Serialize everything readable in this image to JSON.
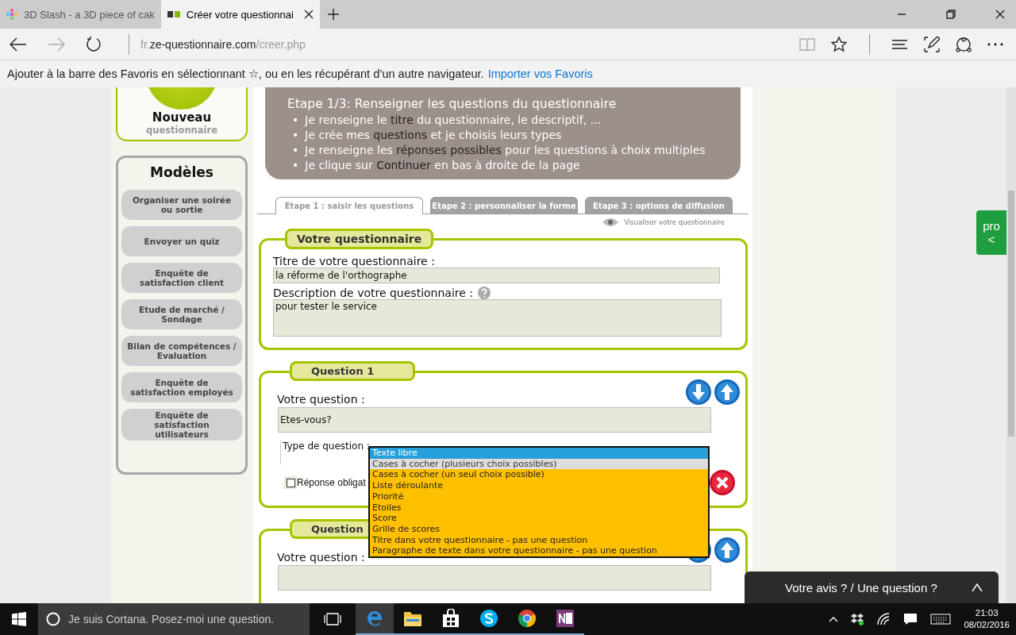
{
  "browser": {
    "tabs": [
      {
        "title": "3D Slash - a 3D piece of cak",
        "kind": "pixels",
        "selected": false
      },
      {
        "title": "Créer votre questionnai",
        "kind": "ze",
        "selected": true
      }
    ],
    "url_parts": [
      {
        "text": "fr.",
        "emphasis": false
      },
      {
        "text": "ze-questionnaire.com",
        "emphasis": true
      },
      {
        "text": "/creer.php",
        "emphasis": false
      }
    ],
    "favorites_bar": {
      "message": "Ajouter à la barre des Favoris en sélectionnant ☆, ou en les récupérant d’un autre navigateur.",
      "link": "Importer vos Favoris"
    }
  },
  "sidebar": {
    "new_button": {
      "title": "Nouveau",
      "subtitle": "questionnaire"
    },
    "templates": {
      "title": "Modèles",
      "items": [
        "Organiser une soirée ou sortie",
        "Envoyer un quiz",
        "Enquête de satisfaction client",
        "Etude de marché / Sondage",
        "Bilan de compétences / Evaluation",
        "Enquête de satisfaction employés",
        "Enquête de satisfaction utilisateurs"
      ]
    }
  },
  "header": {
    "step": "Etape 1/3: Renseigner les questions du questionnaire",
    "bullets": [
      {
        "marker": "•",
        "text": "Je renseigne le **titre** du questionnaire, le descriptif, ..."
      },
      {
        "marker": "•",
        "text": "Je crée mes **questions** et je choisis leurs types"
      },
      {
        "marker": "•",
        "text": "Je renseigne les **réponses possibles** pour les questions à choix multiples"
      },
      {
        "marker": "•",
        "text": "Je clique sur **Continuer** en bas à droite de la page"
      }
    ]
  },
  "step_tabs": [
    {
      "label": "Etape 1 : saisir les questions",
      "selected": true
    },
    {
      "label": "Etape 2 : personnaliser la forme",
      "selected": false
    },
    {
      "label": "Etape 3 : options de diffusion",
      "selected": false
    }
  ],
  "preview_link": "Visualiser votre questionnaire",
  "questionnaire": {
    "heading": "Votre questionnaire",
    "title_label": "Titre de votre questionnaire :",
    "title_value": "la réforme de l'orthographe",
    "description_label": "Description de votre questionnaire :",
    "description_value": "pour tester le service"
  },
  "questions": [
    {
      "heading": "Question 1",
      "question_label": "Votre question :",
      "question_value": "Etes-vous?",
      "type_label": "Type de question :",
      "required_label": "Réponse obligat",
      "required": false
    },
    {
      "heading": "Question",
      "question_label": "Votre question :"
    }
  ],
  "type_dropdown": {
    "options": [
      {
        "label": "Texte libre",
        "selected": true,
        "hovered": false
      },
      {
        "label": "Cases à cocher (plusieurs choix possibles)",
        "selected": false,
        "hovered": true
      },
      {
        "label": "Cases à cocher (un seul choix possible)",
        "selected": false,
        "hovered": false
      },
      {
        "label": "Liste déroulante",
        "selected": false,
        "hovered": false
      },
      {
        "label": "Priorité",
        "selected": false,
        "hovered": false
      },
      {
        "label": "Etoiles",
        "selected": false,
        "hovered": false
      },
      {
        "label": "Score",
        "selected": false,
        "hovered": false
      },
      {
        "label": "Grille de scores",
        "selected": false,
        "hovered": false
      },
      {
        "label": "Titre dans votre questionnaire - pas une question",
        "selected": false,
        "hovered": false
      },
      {
        "label": "Paragraphe de texte dans votre questionnaire - pas une question",
        "selected": false,
        "hovered": false
      }
    ]
  },
  "side_tab": {
    "label": "pro",
    "arrow": "<"
  },
  "feedback_bar": {
    "label": "Votre avis ? / Une question ?"
  },
  "taskbar": {
    "search_placeholder": "Je suis Cortana. Posez-moi une question.",
    "apps": [
      {
        "kind": "edge",
        "active": true
      },
      {
        "kind": "explorer",
        "active": false
      },
      {
        "kind": "store",
        "active": false
      },
      {
        "kind": "skype",
        "active": false
      },
      {
        "kind": "chrome",
        "active": false
      },
      {
        "kind": "onenote",
        "active": false
      }
    ],
    "time": "21:03",
    "date": "08/02/2016"
  }
}
